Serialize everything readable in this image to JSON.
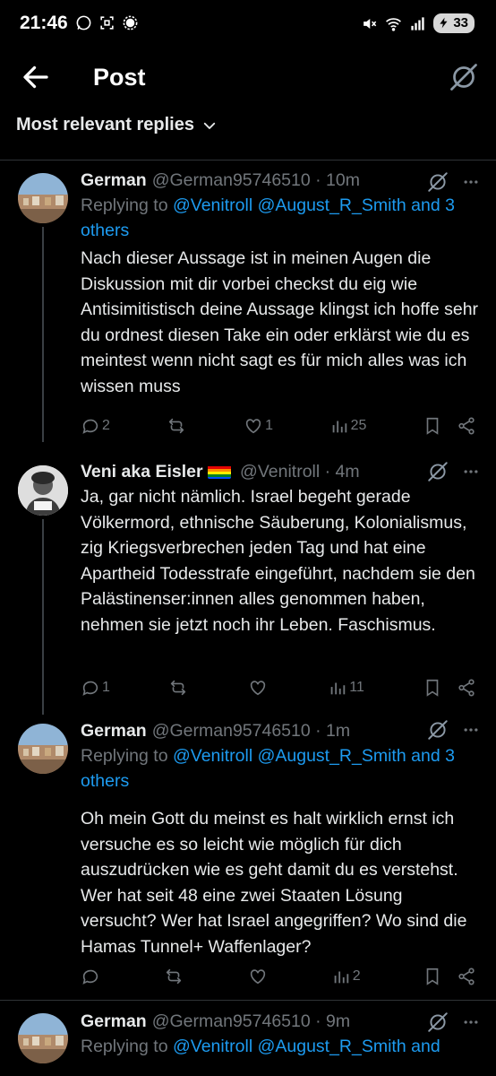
{
  "status": {
    "time": "21:46",
    "battery": "33"
  },
  "header": {
    "title": "Post"
  },
  "sort": {
    "label": "Most relevant replies"
  },
  "posts": [
    {
      "name": "German",
      "handle": "@German95746510",
      "time": "10m",
      "replying_prefix": "Replying to",
      "mention1": "@Venitroll",
      "mention2": "@August_R_Smith",
      "and": "and",
      "others": "3 others",
      "text": "Nach dieser Aussage ist in meinen Augen die Diskussion mit dir vorbei checkst du eig wie Antisimitistisch deine Aussage klingst ich hoffe sehr du ordnest diesen Take ein oder erklärst wie du es meintest wenn nicht sagt es für mich alles was ich wissen muss",
      "replies": "2",
      "reposts": "",
      "likes": "1",
      "views": "25"
    },
    {
      "name": "Veni aka Eisler",
      "handle": "@Venitroll",
      "time": "4m",
      "text": "Ja, gar nicht nämlich. Israel begeht gerade Völkermord, ethnische Säuberung, Kolonialismus, zig Kriegsverbrechen jeden Tag und hat eine Apartheid Todesstrafe eingeführt, nachdem sie den Palästinenser:innen alles genommen haben, nehmen sie jetzt noch ihr Leben. Faschismus.",
      "replies": "1",
      "reposts": "",
      "likes": "",
      "views": "11"
    },
    {
      "name": "German",
      "handle": "@German95746510",
      "time": "1m",
      "replying_prefix": "Replying to",
      "mention1": "@Venitroll",
      "mention2": "@August_R_Smith",
      "and": "and",
      "others": "3 others",
      "text": "Oh mein Gott du meinst es halt wirklich ernst ich versuche es so leicht wie möglich für dich auszudrücken wie es geht damit du es verstehst. Wer hat seit 48 eine zwei Staaten Lösung versucht? Wer hat Israel angegriffen? Wo sind die Hamas Tunnel+ Waffenlager?",
      "replies": "",
      "reposts": "",
      "likes": "",
      "views": "2"
    },
    {
      "name": "German",
      "handle": "@German95746510",
      "time": "9m",
      "replying_prefix": "Replying to",
      "mention1": "@Venitroll",
      "mention2": "@August_R_Smith",
      "and": "and"
    }
  ],
  "colors": {
    "background": "#000000",
    "text": "#e7e9ea",
    "muted": "#71767b",
    "accent": "#1d9bf0"
  },
  "icons": [
    "back-arrow-icon",
    "grok-icon",
    "chevron-down-icon",
    "reply-icon",
    "repost-icon",
    "like-icon",
    "views-icon",
    "bookmark-icon",
    "share-icon"
  ]
}
